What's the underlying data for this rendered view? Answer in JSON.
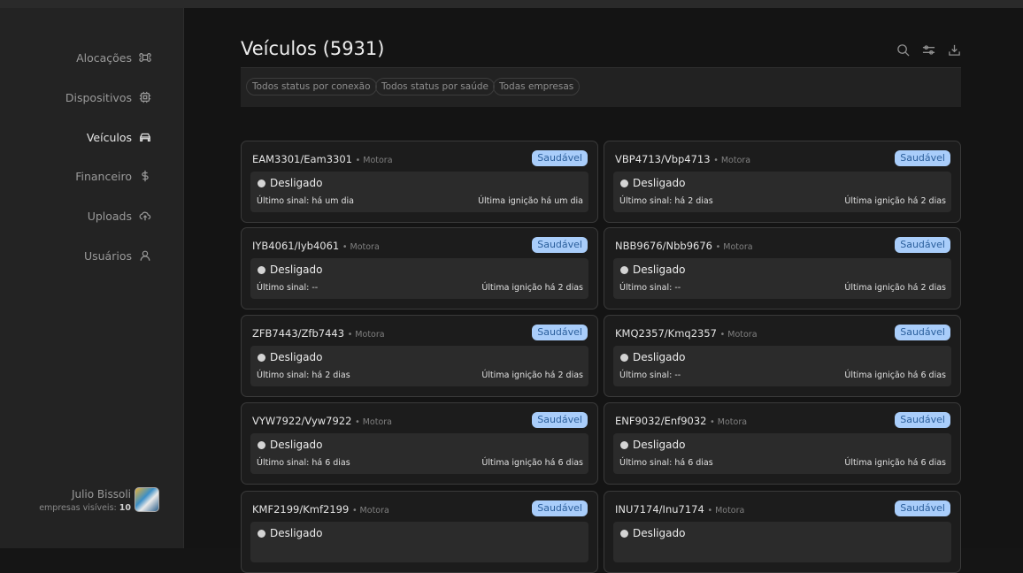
{
  "sidebar": {
    "items": [
      {
        "label": "Alocações",
        "icon": "command-icon"
      },
      {
        "label": "Dispositivos",
        "icon": "chip-icon"
      },
      {
        "label": "Veículos",
        "icon": "car-icon",
        "active": true
      },
      {
        "label": "Financeiro",
        "icon": "dollar-icon"
      },
      {
        "label": "Uploads",
        "icon": "cloud-upload-icon"
      },
      {
        "label": "Usuários",
        "icon": "user-icon"
      }
    ],
    "user": {
      "name": "Julio Bissoli",
      "companies_label": "empresas visíveis:",
      "companies_count": "10"
    }
  },
  "main": {
    "title": "Veículos (5931)",
    "filters": [
      "Todos status por conexão",
      "Todos status por saúde",
      "Todas empresas"
    ],
    "vehicles": [
      {
        "plate": "EAM3301/Eam3301",
        "type": "Motora",
        "health": "Saudável",
        "state": "Desligado",
        "signal": "Último sinal: há um dia",
        "ignition": "Última ignição há um dia"
      },
      {
        "plate": "VBP4713/Vbp4713",
        "type": "Motora",
        "health": "Saudável",
        "state": "Desligado",
        "signal": "Último sinal: há 2 dias",
        "ignition": "Última ignição há 2 dias"
      },
      {
        "plate": "IYB4061/Iyb4061",
        "type": "Motora",
        "health": "Saudável",
        "state": "Desligado",
        "signal": "Último sinal: --",
        "ignition": "Última ignição há 2 dias"
      },
      {
        "plate": "NBB9676/Nbb9676",
        "type": "Motora",
        "health": "Saudável",
        "state": "Desligado",
        "signal": "Último sinal: --",
        "ignition": "Última ignição há 2 dias"
      },
      {
        "plate": "ZFB7443/Zfb7443",
        "type": "Motora",
        "health": "Saudável",
        "state": "Desligado",
        "signal": "Último sinal: há 2 dias",
        "ignition": "Última ignição há 2 dias"
      },
      {
        "plate": "KMQ2357/Kmq2357",
        "type": "Motora",
        "health": "Saudável",
        "state": "Desligado",
        "signal": "Último sinal: --",
        "ignition": "Última ignição há 6 dias"
      },
      {
        "plate": "VYW7922/Vyw7922",
        "type": "Motora",
        "health": "Saudável",
        "state": "Desligado",
        "signal": "Último sinal: há 6 dias",
        "ignition": "Última ignição há 6 dias"
      },
      {
        "plate": "ENF9032/Enf9032",
        "type": "Motora",
        "health": "Saudável",
        "state": "Desligado",
        "signal": "Último sinal: há 6 dias",
        "ignition": "Última ignição há 6 dias"
      },
      {
        "plate": "KMF2199/Kmf2199",
        "type": "Motora",
        "health": "Saudável",
        "state": "Desligado",
        "signal": "",
        "ignition": ""
      },
      {
        "plate": "INU7174/Inu7174",
        "type": "Motora",
        "health": "Saudável",
        "state": "Desligado",
        "signal": "",
        "ignition": ""
      }
    ]
  },
  "colors": {
    "badge_bg": "#a9cdfa",
    "badge_text": "#2b5f9c",
    "background": "#141414",
    "sidebar": "#232323"
  }
}
